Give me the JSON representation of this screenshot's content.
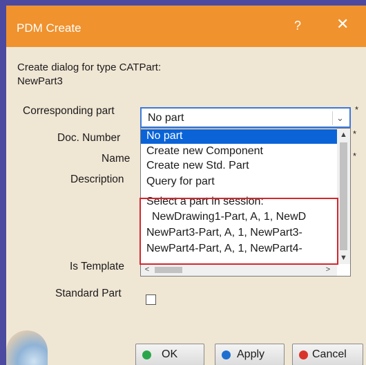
{
  "dialog": {
    "title": "PDM Create",
    "help_label": "?",
    "close_label": "✕"
  },
  "info": {
    "line1": "Create dialog for type CATPart:",
    "line2": "NewPart3"
  },
  "fields": {
    "corresponding_part_label": "Corresponding part",
    "doc_number_label": "Doc. Number",
    "name_label": "Name",
    "description_label": "Description",
    "is_template_label": "Is Template",
    "standard_part_label": "Standard Part",
    "required_marker": "*"
  },
  "combo": {
    "value": "No part",
    "arrow": "⌄"
  },
  "dropdown": {
    "options": [
      "No part",
      "Create new Component",
      "Create new Std. Part",
      "Query for part",
      "Select a part in session:",
      "NewDrawing1-Part, A, 1, NewD",
      "NewPart3-Part, A, 1, NewPart3-",
      "NewPart4-Part, A, 1, NewPart4-"
    ],
    "selected_index": 0,
    "scroll_up": "▲",
    "scroll_down": "▼",
    "scroll_left": "<",
    "scroll_right": ">"
  },
  "buttons": {
    "ok_label": "OK",
    "apply_label": "Apply",
    "cancel_label": "Cancel"
  },
  "colors": {
    "titlebar": "#f0922d",
    "dialog_bg": "#f0e6d4",
    "selection": "#0a64d8",
    "highlight_box": "#d4262e",
    "ok_dot": "#2aa64a",
    "apply_dot": "#1f6fd0",
    "cancel_dot": "#d9342b"
  }
}
